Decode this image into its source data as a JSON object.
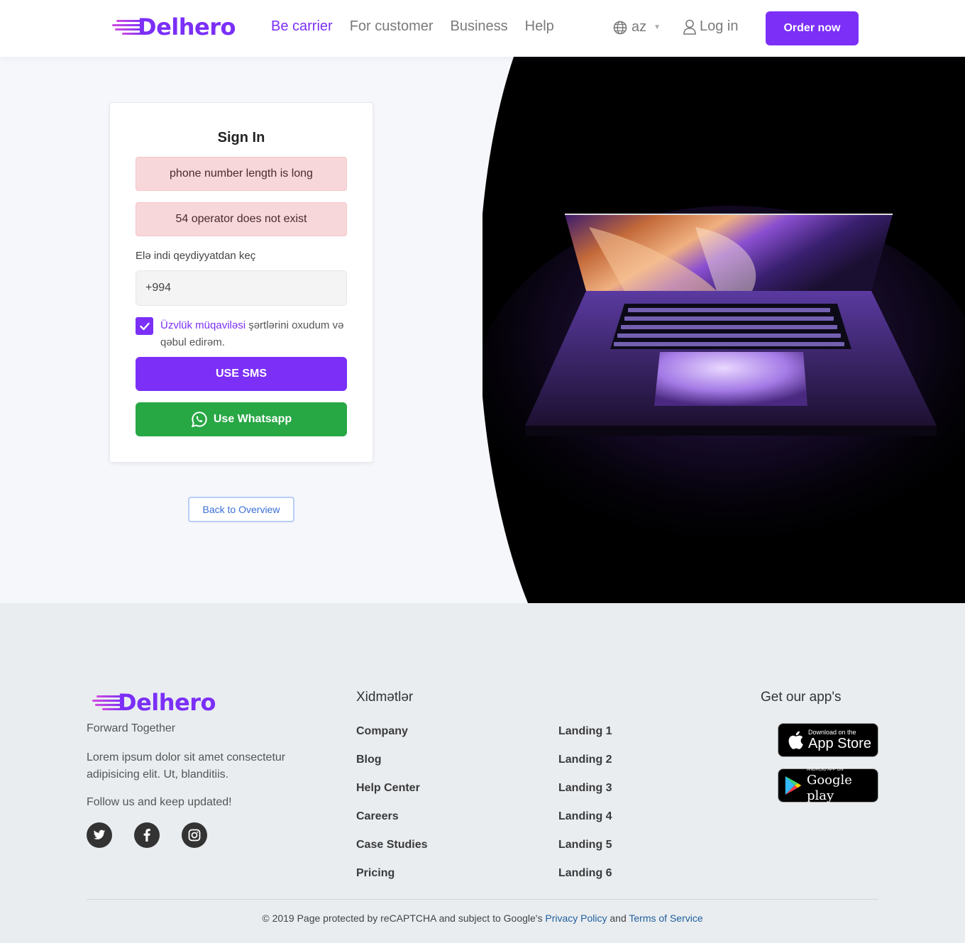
{
  "header": {
    "brand": "Delhero",
    "nav": [
      {
        "label": "Be carrier",
        "active": true
      },
      {
        "label": "For customer",
        "active": false
      },
      {
        "label": "Business",
        "active": false
      },
      {
        "label": "Help",
        "active": false
      }
    ],
    "language": "az",
    "login_label": "Log in",
    "order_label": "Order now"
  },
  "signin": {
    "title": "Sign In",
    "alerts": [
      "phone number length is long",
      "54 operator does not exist"
    ],
    "phone_label": "Elə indi qeydiyyatdan keç",
    "phone_value": "+994",
    "agreement_link": "Üzvlük müqaviləsi",
    "agreement_rest": " şərtlərini oxudum və qəbul edirəm.",
    "agreement_checked": true,
    "sms_button": "USE SMS",
    "whatsapp_button": "Use Whatsapp",
    "back_button": "Back to Overview"
  },
  "footer": {
    "brand": "Delhero",
    "tagline": "Forward Together",
    "description": "Lorem ipsum dolor sit amet consectetur adipisicing elit. Ut, blanditiis.",
    "follow": "Follow us and keep updated!",
    "social": [
      "twitter-icon",
      "facebook-icon",
      "instagram-icon"
    ],
    "services_title": "Xidmətlər",
    "services_col1": [
      "Company",
      "Blog",
      "Help Center",
      "Careers",
      "Case Studies",
      "Pricing"
    ],
    "services_col2": [
      "Landing 1",
      "Landing 2",
      "Landing 3",
      "Landing 4",
      "Landing 5",
      "Landing 6"
    ],
    "apps_title": "Get our app's",
    "app_store": {
      "small": "Download on the",
      "big": "App Store"
    },
    "google_play": {
      "small": "ANDROID APP ON",
      "big": "Google play"
    },
    "copyright_prefix": "© 2019 Page protected by reCAPTCHA and subject to Google's ",
    "privacy_link": "Privacy Policy",
    "copyright_and": " and ",
    "terms_link": "Terms of Service"
  },
  "colors": {
    "accent": "#7b2ff7",
    "success": "#28a745",
    "alert_bg": "#f8d7da",
    "footer_bg": "#e9edf0"
  }
}
